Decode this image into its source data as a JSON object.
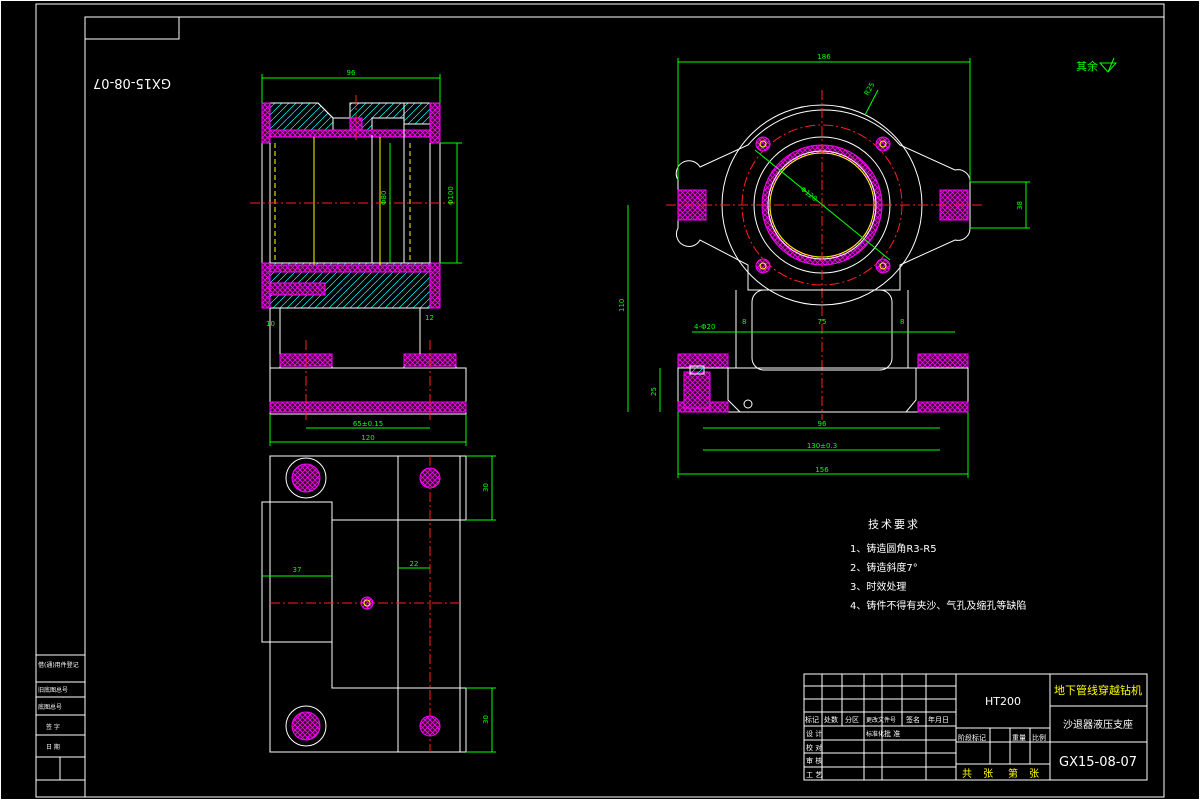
{
  "drawing_number_stamp": "GX15-08-07",
  "roughness_note": "其余",
  "tech_requirements": {
    "title": "技术要求",
    "items": [
      "1、铸造圆角R3-R5",
      "2、铸造斜度7°",
      "3、时效处理",
      "4、铸件不得有夹沙、气孔及缩孔等缺陷"
    ]
  },
  "title_block": {
    "material": "HT200",
    "project": "地下管线穿越钻机",
    "part_name": "沙退器液压支座",
    "drawing_no": "GX15-08-07",
    "header_cols": [
      "标记",
      "处数",
      "分区",
      "更改文件号",
      "签名",
      "年月日"
    ],
    "left_rows": [
      "设 计",
      "校 对",
      "审 核",
      "工 艺"
    ],
    "right_labels": [
      "阶段标记",
      "重量",
      "比例"
    ],
    "sheets": [
      "共 张",
      "第 张"
    ],
    "standardize": "标准化",
    "approve": "批 准"
  },
  "side_table": [
    "借(通)用件登记",
    "旧底图总号",
    "底图总号",
    "签 字",
    "日 期"
  ],
  "dimensions": {
    "top_width": "96",
    "left_width": "120",
    "left_inner": "65±0.15",
    "front_top": "186",
    "front_height": "110",
    "front_span": "156",
    "front_span_tol": "130±0.3",
    "front_inner": "96",
    "front_lug": "4-Φ20",
    "front_mid": "75",
    "bottom_w": "37",
    "bottom_w2": "22",
    "circle_d": "Φ120",
    "small_r": "R25",
    "side_h": "38",
    "side_h2": "25",
    "side_8": "8",
    "side_bot": "30",
    "side_30": "30",
    "side_10": "10",
    "side_12": "12",
    "bore1": "Φ80",
    "bore2": "Φ100"
  }
}
